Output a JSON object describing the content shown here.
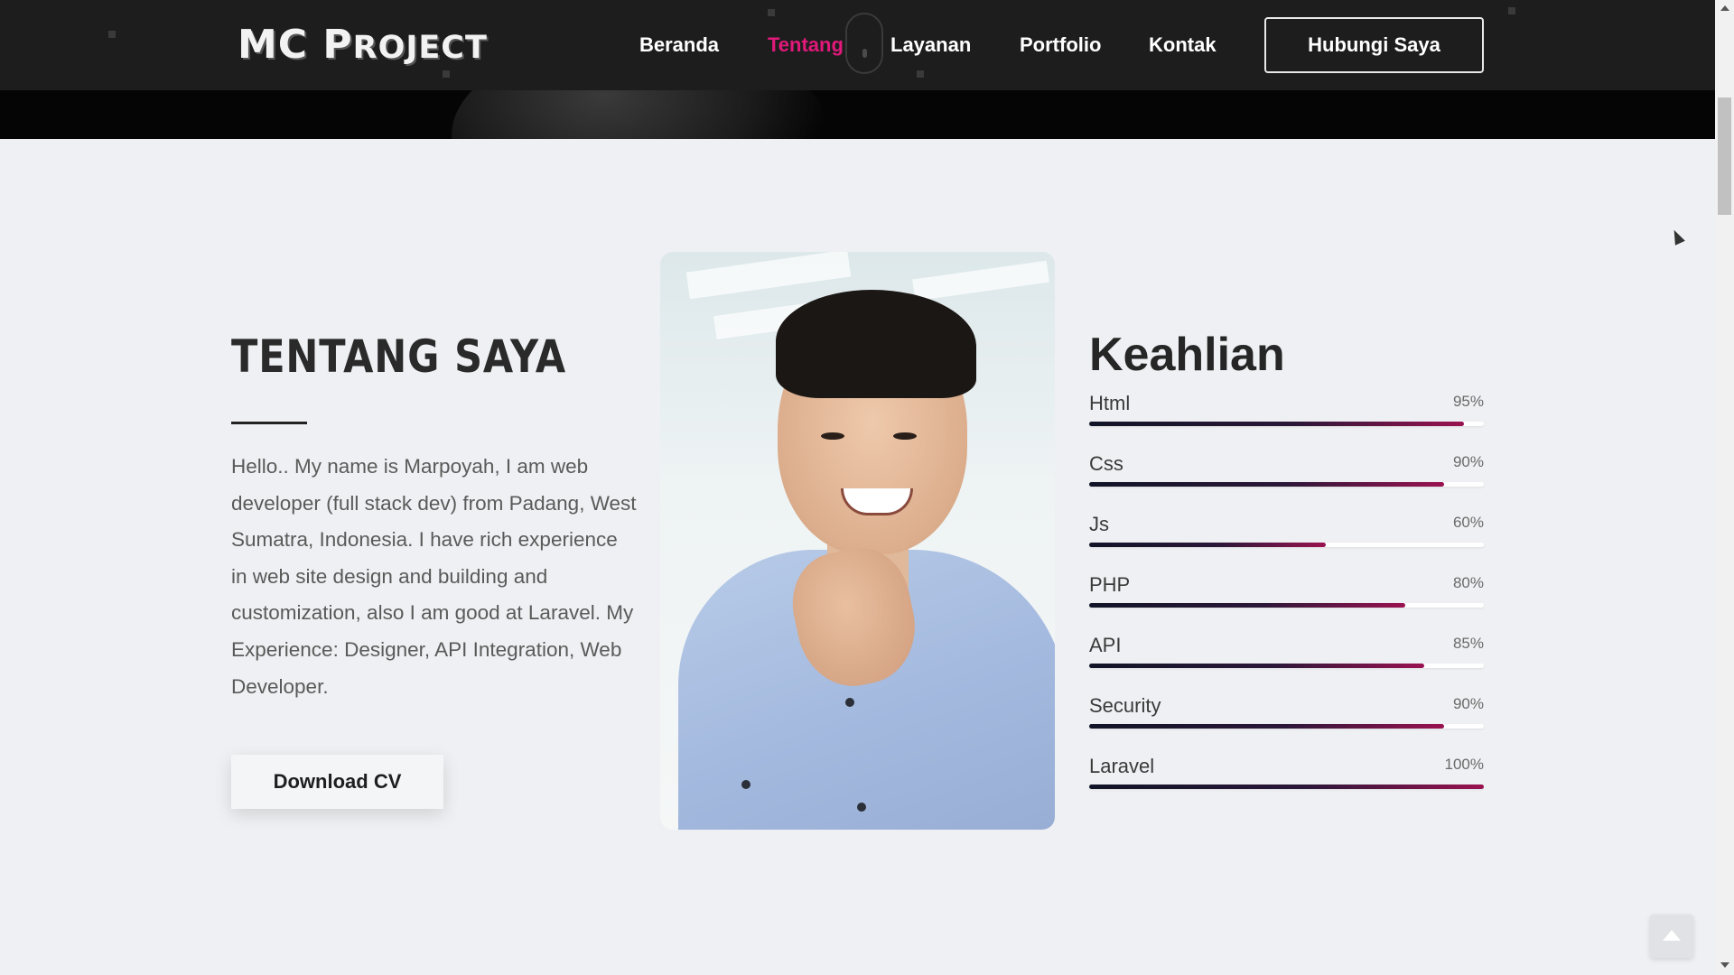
{
  "header": {
    "logo_main": "MC P",
    "logo_rest": "ROJECT",
    "nav": [
      {
        "label": "Beranda",
        "active": false
      },
      {
        "label": "Tentang",
        "active": true
      },
      {
        "label": "Layanan",
        "active": false
      },
      {
        "label": "Portfolio",
        "active": false
      },
      {
        "label": "Kontak",
        "active": false
      }
    ],
    "cta_label": "Hubungi Saya"
  },
  "about": {
    "title": "TENTANG SAYA",
    "text": "Hello.. My name is Marpoyah, I am web developer (full stack dev) from Padang, West Sumatra, Indonesia. I have rich experience in web site design and building and customization, also I am good at Laravel. My Experience: Designer, API Integration, Web Developer.",
    "download_label": "Download CV"
  },
  "skills": {
    "title": "Keahlian",
    "items": [
      {
        "name": "Html",
        "percent_label": "95%",
        "value": 95
      },
      {
        "name": "Css",
        "percent_label": "90%",
        "value": 90
      },
      {
        "name": "Js",
        "percent_label": "60%",
        "value": 60
      },
      {
        "name": "PHP",
        "percent_label": "80%",
        "value": 80
      },
      {
        "name": "API",
        "percent_label": "85%",
        "value": 85
      },
      {
        "name": "Security",
        "percent_label": "90%",
        "value": 90
      },
      {
        "name": "Laravel",
        "percent_label": "100%",
        "value": 100
      }
    ]
  },
  "colors": {
    "accent": "#e0197a",
    "nav_bg": "#1d1d1d",
    "page_bg": "#eff0f3"
  },
  "icons": [
    "mouse-scroll-icon",
    "arrow-up-icon",
    "cursor-icon"
  ]
}
